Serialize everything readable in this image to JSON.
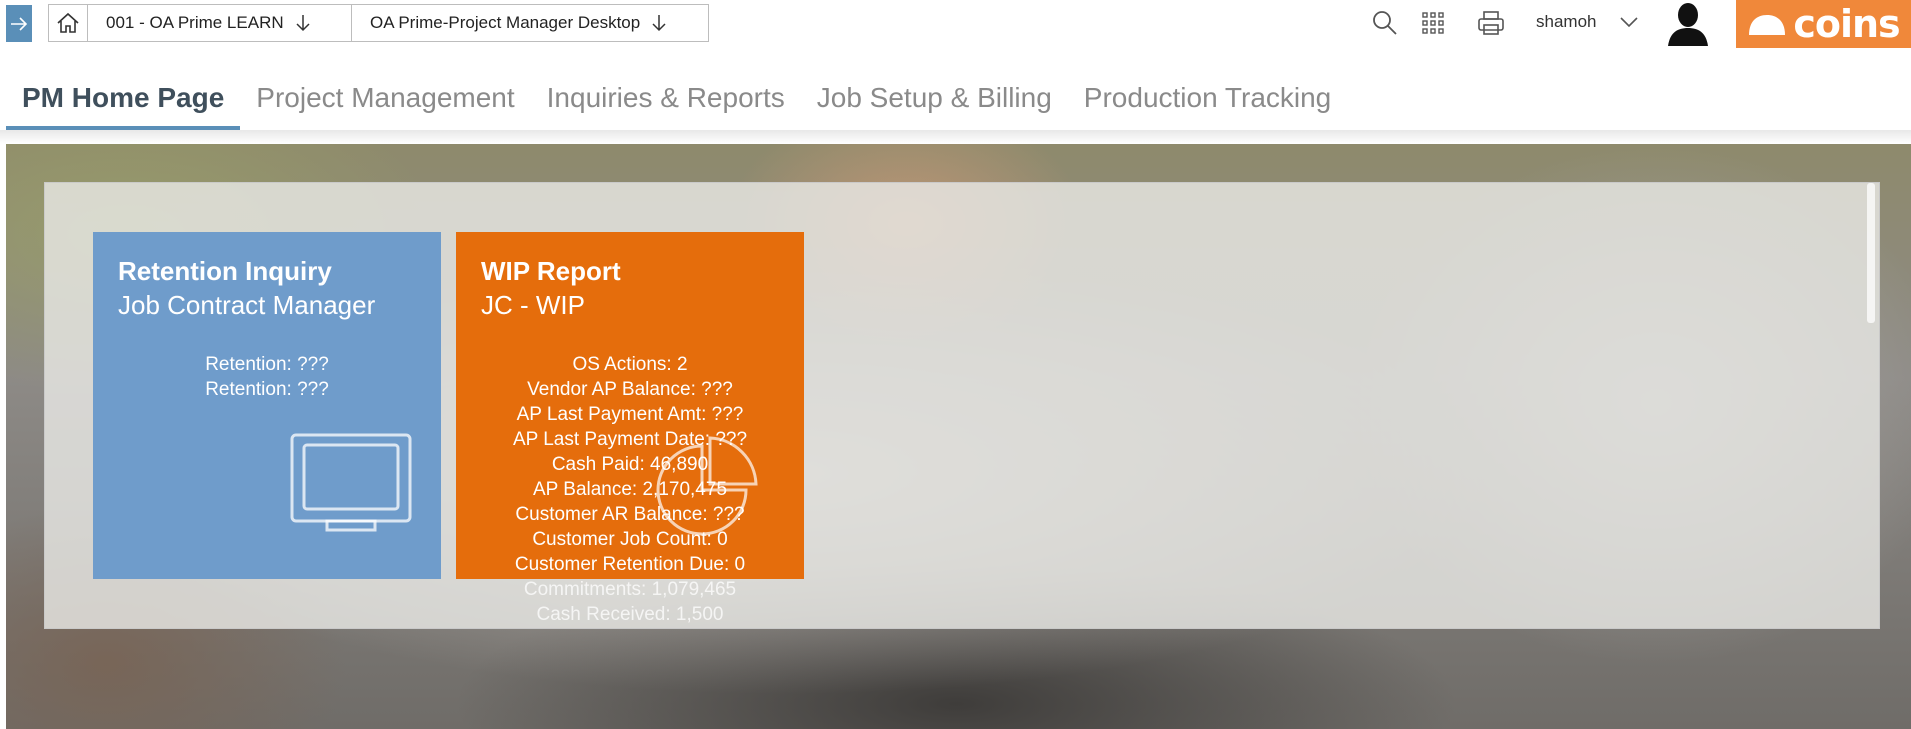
{
  "breadcrumb": {
    "items": [
      {
        "label": "001 - OA Prime LEARN"
      },
      {
        "label": "OA Prime-Project Manager Desktop"
      }
    ]
  },
  "header": {
    "username": "shamoh",
    "brand": "coins"
  },
  "nav": {
    "tabs": [
      {
        "label": "PM Home Page",
        "active": true
      },
      {
        "label": "Project Management"
      },
      {
        "label": "Inquiries & Reports"
      },
      {
        "label": "Job Setup & Billing"
      },
      {
        "label": "Production Tracking"
      }
    ]
  },
  "tiles": [
    {
      "title": "Retention Inquiry",
      "subtitle": "Job Contract Manager",
      "lines": [
        "Retention: ???",
        "Retention: ???"
      ],
      "icon": "monitor-icon",
      "color": "#6f9ccb"
    },
    {
      "title": "WIP Report",
      "subtitle": "JC - WIP",
      "lines": [
        "OS Actions: 2",
        "Vendor AP Balance: ???",
        "AP Last Payment Amt: ???",
        "AP Last Payment Date: ???",
        "Cash Paid: 46,890",
        "AP Balance: 2,170,475",
        "Customer AR Balance: ???",
        "Customer Job Count: 0",
        "Customer Retention Due: 0",
        "Commitments: 1,079,465",
        "Cash Received: 1,500"
      ],
      "icon": "pie-chart-icon",
      "color": "#e56d0c"
    }
  ],
  "colors": {
    "accent": "#5a8fb8",
    "brand": "#f0883a"
  }
}
